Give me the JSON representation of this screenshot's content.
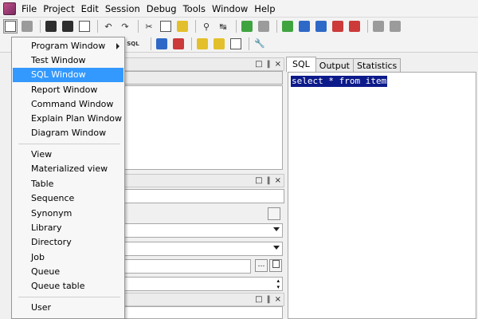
{
  "menubar": {
    "items": [
      {
        "label": "File"
      },
      {
        "label": "Project"
      },
      {
        "label": "Edit"
      },
      {
        "label": "Session"
      },
      {
        "label": "Debug"
      },
      {
        "label": "Tools"
      },
      {
        "label": "Window"
      },
      {
        "label": "Help"
      }
    ]
  },
  "toolbar2": {
    "sql_label": "SQL"
  },
  "new_menu": {
    "items": [
      {
        "label": "Program Window",
        "has_submenu": true
      },
      {
        "label": "Test Window"
      },
      {
        "label": "SQL Window",
        "highlighted": true
      },
      {
        "label": "Report Window"
      },
      {
        "label": "Command Window"
      },
      {
        "label": "Explain Plan Window"
      },
      {
        "label": "Diagram Window"
      },
      {
        "label": "View"
      },
      {
        "label": "Materialized view"
      },
      {
        "label": "Table"
      },
      {
        "label": "Sequence"
      },
      {
        "label": "Synonym"
      },
      {
        "label": "Library"
      },
      {
        "label": "Directory"
      },
      {
        "label": "Job"
      },
      {
        "label": "Queue"
      },
      {
        "label": "Queue table"
      },
      {
        "label": "User"
      }
    ]
  },
  "panel_controls": {
    "pin": "□",
    "float": "‖",
    "close": "×"
  },
  "sql_window": {
    "tabs": [
      {
        "label": "SQL",
        "active": true
      },
      {
        "label": "Output"
      },
      {
        "label": "Statistics"
      }
    ],
    "query": "select * from item"
  },
  "colors": {
    "selection": "#0c1a8a",
    "menu_highlight": "#3399ff"
  }
}
